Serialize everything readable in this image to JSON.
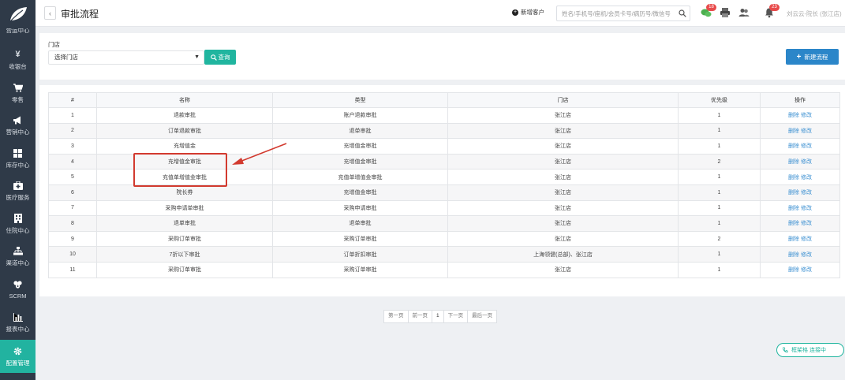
{
  "sidebar": {
    "partial_label": "营运中心",
    "items": [
      {
        "label": "收银台",
        "icon": "yen-icon"
      },
      {
        "label": "零售",
        "icon": "cart-icon"
      },
      {
        "label": "营销中心",
        "icon": "megaphone-icon"
      },
      {
        "label": "库存中心",
        "icon": "grid-icon"
      },
      {
        "label": "医疗服务",
        "icon": "medical-kit-icon"
      },
      {
        "label": "住院中心",
        "icon": "hospital-icon"
      },
      {
        "label": "渠道中心",
        "icon": "org-chart-icon"
      },
      {
        "label": "SCRM",
        "icon": "users-icon"
      },
      {
        "label": "报表中心",
        "icon": "bar-chart-icon"
      },
      {
        "label": "配置管理",
        "icon": "gear-icon",
        "active": true
      }
    ]
  },
  "header": {
    "back_label": "‹",
    "title": "审批流程",
    "new_customer_label": "新增客户",
    "search_placeholder": "姓名/手机号/座机/会员卡号/病历号/微信号",
    "chat_badge": "18",
    "bell_badge": "23",
    "user_name": "刘云云-院长 (张江店)"
  },
  "filter": {
    "store_label": "门店",
    "store_selected": "选择门店",
    "query_label": "查询",
    "new_flow_label": "新建流程"
  },
  "table": {
    "columns": [
      "#",
      "名称",
      "类型",
      "门店",
      "优先级",
      "操作"
    ],
    "delete_label": "删除",
    "edit_label": "修改",
    "rows": [
      {
        "no": "1",
        "name": "退款审批",
        "type": "账户退款审批",
        "store": "张江店",
        "priority": "1"
      },
      {
        "no": "2",
        "name": "订单退款审批",
        "type": "退单审批",
        "store": "张江店",
        "priority": "1"
      },
      {
        "no": "3",
        "name": "充增值金",
        "type": "充增值金审批",
        "store": "张江店",
        "priority": "1"
      },
      {
        "no": "4",
        "name": "充增值金审批",
        "type": "充增值金审批",
        "store": "张江店",
        "priority": "2"
      },
      {
        "no": "5",
        "name": "充值单增值金审批",
        "type": "充值单增值金审批",
        "store": "张江店",
        "priority": "1"
      },
      {
        "no": "6",
        "name": "院长券",
        "type": "充增值金审批",
        "store": "张江店",
        "priority": "1"
      },
      {
        "no": "7",
        "name": "采购申请单审批",
        "type": "采购申请审批",
        "store": "张江店",
        "priority": "1"
      },
      {
        "no": "8",
        "name": "退单审批",
        "type": "退单审批",
        "store": "张江店",
        "priority": "1"
      },
      {
        "no": "9",
        "name": "采购订单审批",
        "type": "采购订单审批",
        "store": "张江店",
        "priority": "2"
      },
      {
        "no": "10",
        "name": "7折以下审批",
        "type": "订单折扣审批",
        "store": "上海领健(总部)、张江店",
        "priority": "1"
      },
      {
        "no": "11",
        "name": "采购订单审批",
        "type": "采购订单审批",
        "store": "张江店",
        "priority": "1"
      }
    ]
  },
  "pagination": {
    "first": "第一页",
    "prev": "前一页",
    "current": "1",
    "next": "下一页",
    "last": "最后一页"
  },
  "float_status": {
    "label": "框架格 连接中"
  },
  "colors": {
    "sidebar_bg": "#2f3a48",
    "accent": "#20b59f",
    "primary_button": "#2b86c9",
    "annotation_red": "#d23a2f",
    "badge_red": "#e84b4b",
    "link_blue": "#3a8fd1"
  }
}
